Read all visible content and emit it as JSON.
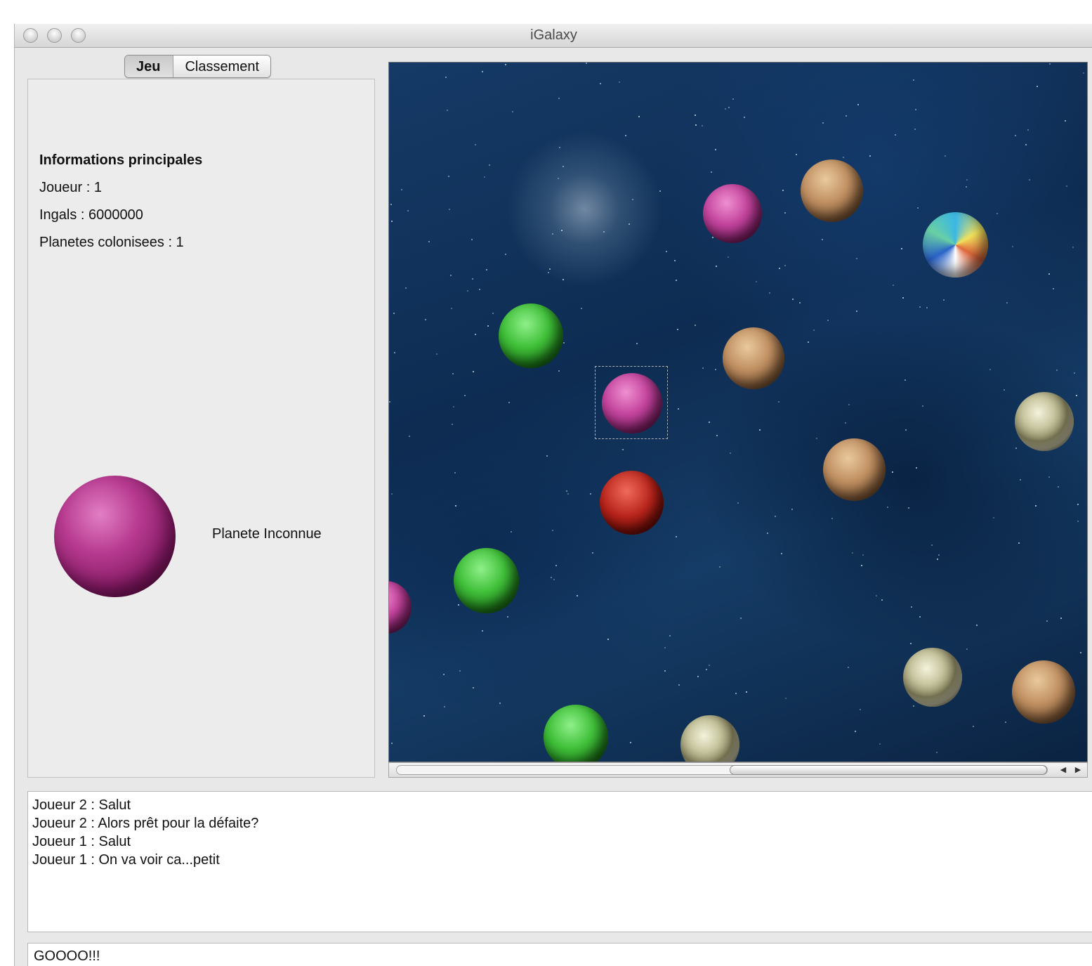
{
  "window": {
    "title": "iGalaxy"
  },
  "tabs": [
    {
      "label": "Jeu",
      "active": true
    },
    {
      "label": "Classement",
      "active": false
    }
  ],
  "info": {
    "heading": "Informations principales",
    "player": "Joueur : 1",
    "ingals": "Ingals : 6000000",
    "colonized": "Planetes colonisees : 1"
  },
  "selected_planet": {
    "label": "Planete Inconnue",
    "color": "pink"
  },
  "chat": {
    "messages": [
      "Joueur 2 : Salut",
      "Joueur 2 : Alors prêt pour la défaite?",
      "Joueur 1 : Salut",
      "Joueur 1 : On va voir ca...petit"
    ],
    "input_value": "GOOOO!!!"
  }
}
